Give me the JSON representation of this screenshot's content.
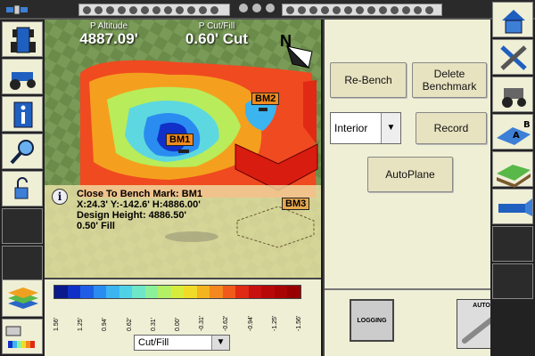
{
  "status_bar": {
    "left_dots": 8,
    "right_dots": 8
  },
  "map": {
    "altitude_label": "P Altitude",
    "altitude_value": "4887.09'",
    "cutfill_label": "P Cut/Fill",
    "cutfill_value": "0.60' Cut",
    "north_label": "N",
    "benchmarks": [
      "BM1",
      "BM2",
      "BM3"
    ]
  },
  "info": {
    "icon": "i",
    "line1": "Close To Bench Mark: BM1",
    "line2": "X:24.3' Y:-142.6' H:4886.00'",
    "line3": "Design Height: 4886.50'",
    "line4": "0.50' Fill"
  },
  "legend": {
    "colors": [
      "#0a1a8c",
      "#1030c8",
      "#1e5ee6",
      "#2a8cf0",
      "#3cb4f0",
      "#50d2e6",
      "#6ee6c8",
      "#8cf09a",
      "#b4f064",
      "#d8ec3c",
      "#f0dc28",
      "#f4b41e",
      "#f4881e",
      "#f05a1a",
      "#e02a14",
      "#c81010",
      "#b80808",
      "#a80404",
      "#980000"
    ],
    "ticks": [
      "1.56'",
      "1.25'",
      "0.94'",
      "0.62'",
      "0.31'",
      "0.00'",
      "-0.31'",
      "-0.62'",
      "-0.94'",
      "-1.25'",
      "-1.56'"
    ],
    "select_value": "Cut/Fill"
  },
  "panel": {
    "rebench": "Re-Bench",
    "delete_benchmark": "Delete Benchmark",
    "mode_value": "Interior",
    "record": "Record",
    "autoplane": "AutoPlane",
    "logging": "LOGGING",
    "auto": "AUTO"
  },
  "right_toolbar": {
    "ab_label_a": "A",
    "ab_label_b": "B"
  }
}
